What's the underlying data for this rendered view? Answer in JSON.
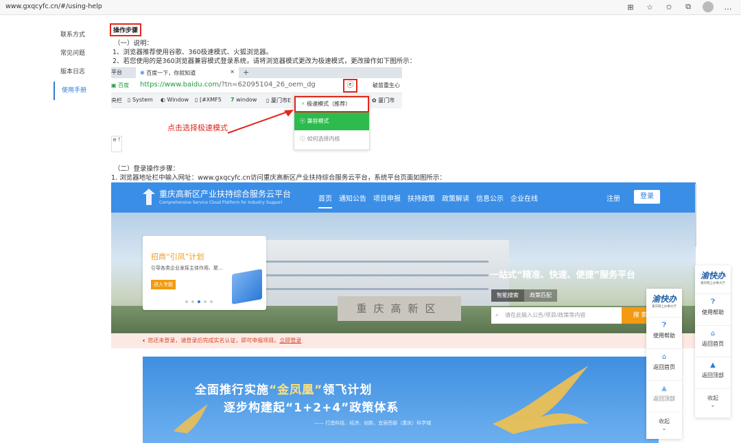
{
  "browser": {
    "url": "www.gxqcyfc.cn/#/using-help",
    "icons": [
      "qr-icon",
      "favorite-add-icon",
      "favorites-icon",
      "collections-icon",
      "profile-avatar"
    ]
  },
  "leftnav": {
    "items": [
      {
        "label": "联系方式"
      },
      {
        "label": "常见问题"
      },
      {
        "label": "版本日志"
      },
      {
        "label": "使用手册"
      }
    ]
  },
  "content": {
    "heading": "操作步骤",
    "section1_title": "（一）说明：",
    "section1_line1": "1、浏览器推荐使用谷歌、360极速模式、火狐浏览器。",
    "section1_line2": "2、若您使用的是360浏览器兼容模式登录系统，请将浏览器模式更改为极速模式，更改操作如下图所示：",
    "section2_title": "（二）登录操作步骤：",
    "section2_line1": "1. 浏览器地址栏中输入网址：www.gxqcyfc.cn访问重庆高新区产业扶持综合服务云平台，系统平台页面如图所示："
  },
  "shot1": {
    "tab_left": "平台",
    "tab_active": "百度一下，你就知道",
    "tab_close": "×",
    "plus": "+",
    "secure": "百度",
    "url_main": "https://www.baidu.com",
    "url_rest": "/?tn=62095104_26_oem_dg",
    "search_text": "破苗重生心",
    "bookmarks": [
      "央栏",
      "System",
      "Window",
      "[#XMF5",
      "window",
      "厦门市E",
      "厦门市"
    ],
    "menu": {
      "speed": "极速模式（推荐）",
      "compat": "兼容模式",
      "howto": "如何选择内核"
    },
    "annotation": "点击选择极速模式",
    "stub": "e !"
  },
  "portal": {
    "title": "重庆高新区产业扶持综合服务云平台",
    "subtitle": "Comprehensive Service Cloud Platform for Industry Support",
    "menu": [
      "首页",
      "通知公告",
      "项目申报",
      "扶持政策",
      "政策解读",
      "信息公示",
      "企业在线"
    ],
    "register": "注册",
    "login": "登录",
    "card_title": "招商“引凤”计划",
    "card_desc": "引导各类企业发挥主体作用、聚...",
    "card_btn": "进入专题",
    "slogan": "一站式“精准、快速、便捷”服务平台",
    "search_tabs": [
      "智能搜索",
      "政策匹配"
    ],
    "search_placeholder": "请在此输入公告/项目/政策等内容",
    "search_btn": "搜 索",
    "stone_text": "重庆高新区",
    "notice_text": "您还未登录，请登录后完成实名认证，即可申报项目。",
    "notice_link": "立即登录",
    "poster_line1a": "全面推行实施",
    "poster_line1b": "“金凤凰”",
    "poster_line1c": "领飞计划",
    "poster_line2": "逐步构建起“1+2+4”政策体系",
    "poster_line3": "—— 打造科技、经济、创新、宜居西部（重庆）科学城"
  },
  "float": {
    "logo": "渝快办",
    "logo_sub": "重庆网上办事大厅",
    "help": "使用帮助",
    "home": "返回首页",
    "top": "返回顶部",
    "collapse": "收起"
  },
  "colors": {
    "accent": "#2a7ad8",
    "red": "#e1261c",
    "orange": "#f39a11",
    "green": "#2dbb4e"
  }
}
